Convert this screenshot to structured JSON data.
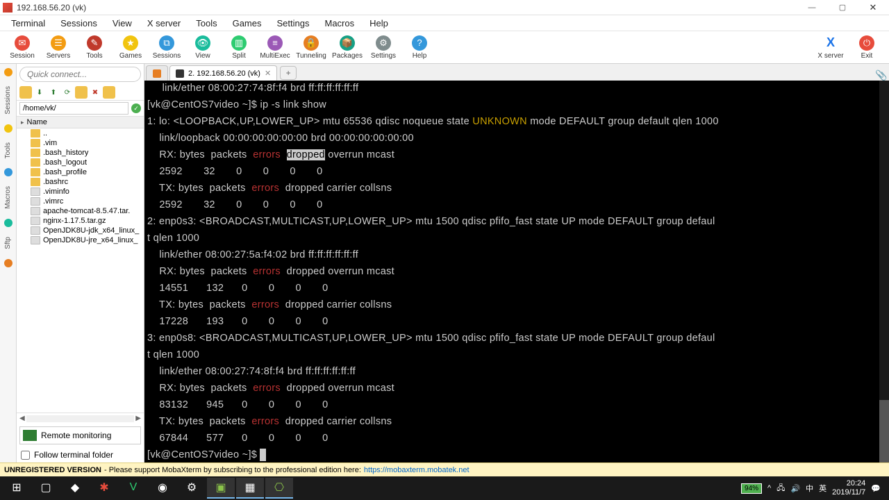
{
  "window": {
    "title": "192.168.56.20 (vk)"
  },
  "menu": [
    "Terminal",
    "Sessions",
    "View",
    "X server",
    "Tools",
    "Games",
    "Settings",
    "Macros",
    "Help"
  ],
  "toolbar": [
    {
      "label": "Session",
      "color": "#e74c3c",
      "glyph": "✉"
    },
    {
      "label": "Servers",
      "color": "#f39c12",
      "glyph": "☰"
    },
    {
      "label": "Tools",
      "color": "#c0392b",
      "glyph": "✎"
    },
    {
      "label": "Games",
      "color": "#f1c40f",
      "glyph": "★"
    },
    {
      "label": "Sessions",
      "color": "#3498db",
      "glyph": "⧉"
    },
    {
      "label": "View",
      "color": "#1abc9c",
      "glyph": "👁"
    },
    {
      "label": "Split",
      "color": "#2ecc71",
      "glyph": "▥"
    },
    {
      "label": "MultiExec",
      "color": "#9b59b6",
      "glyph": "≡"
    },
    {
      "label": "Tunneling",
      "color": "#e67e22",
      "glyph": "🔒"
    },
    {
      "label": "Packages",
      "color": "#16a085",
      "glyph": "📦"
    },
    {
      "label": "Settings",
      "color": "#7f8c8d",
      "glyph": "⚙"
    },
    {
      "label": "Help",
      "color": "#3498db",
      "glyph": "?"
    }
  ],
  "toolbar_right": [
    {
      "label": "X server",
      "glyph": "X"
    },
    {
      "label": "Exit",
      "glyph": "⏻"
    }
  ],
  "quick_placeholder": "Quick connect...",
  "leftstrip": [
    "Sessions",
    "Tools",
    "Macros",
    "Sftp"
  ],
  "path": "/home/vk/",
  "filehead": "Name",
  "files": [
    {
      "name": "..",
      "dir": true
    },
    {
      "name": ".vim",
      "dir": true
    },
    {
      "name": ".bash_history",
      "dir": true
    },
    {
      "name": ".bash_logout",
      "dir": true
    },
    {
      "name": ".bash_profile",
      "dir": true
    },
    {
      "name": ".bashrc",
      "dir": true
    },
    {
      "name": ".viminfo",
      "dir": false
    },
    {
      "name": ".vimrc",
      "dir": false
    },
    {
      "name": "apache-tomcat-8.5.47.tar.",
      "dir": false
    },
    {
      "name": "nginx-1.17.5.tar.gz",
      "dir": false
    },
    {
      "name": "OpenJDK8U-jdk_x64_linux_",
      "dir": false
    },
    {
      "name": "OpenJDK8U-jre_x64_linux_",
      "dir": false
    }
  ],
  "remote_mon": "Remote monitoring",
  "follow": "Follow terminal folder",
  "tabs": {
    "active_label": "2. 192.168.56.20 (vk)"
  },
  "term": {
    "l0": "     link/ether 08:00:27:74:8f:f4 brd ff:ff:ff:ff:ff:ff",
    "prompt1": "[vk@CentOS7video ~]$ ",
    "cmd": "ip -s link show",
    "i1a": "1: lo: <LOOPBACK,UP,LOWER_UP> mtu 65536 qdisc noqueue state ",
    "unk": "UNKNOWN",
    "i1b": " mode DEFAULT group default qlen 1000",
    "i1link": "    link/loopback 00:00:00:00:00:00 brd 00:00:00:00:00:00",
    "rxh_a": "    RX: bytes  packets  ",
    "err": "errors",
    "rxh_b": "  ",
    "dropped": "dropped",
    "rxh_c": " overrun mcast",
    "i1rx": "    2592       32       0       0       0       0",
    "txh_a": "    TX: bytes  packets  ",
    "txh_b": "  dropped carrier collsns",
    "i1tx": "    2592       32       0       0       0       0",
    "i2": "2: enp0s3: <BROADCAST,MULTICAST,UP,LOWER_UP> mtu 1500 qdisc pfifo_fast state UP mode DEFAULT group defaul",
    "i2b": "t qlen 1000",
    "i2link": "    link/ether 08:00:27:5a:f4:02 brd ff:ff:ff:ff:ff:ff",
    "rxh2_b": "  dropped overrun mcast",
    "i2rx": "    14551      132      0       0       0       0",
    "i2tx": "    17228      193      0       0       0       0",
    "i3": "3: enp0s8: <BROADCAST,MULTICAST,UP,LOWER_UP> mtu 1500 qdisc pfifo_fast state UP mode DEFAULT group defaul",
    "i3b": "t qlen 1000",
    "i3link": "    link/ether 08:00:27:74:8f:f4 brd ff:ff:ff:ff:ff:ff",
    "i3rx": "    83132      945      0       0       0       0",
    "i3tx": "    67844      577      0       0       0       0",
    "prompt2": "[vk@CentOS7video ~]$ "
  },
  "status": {
    "unreg": "UNREGISTERED VERSION",
    "msg": " - Please support MobaXterm by subscribing to the professional edition here: ",
    "url": "https://mobaxterm.mobatek.net"
  },
  "tray": {
    "battery": "94%",
    "ime1": "中",
    "ime2": "英",
    "time": "20:24",
    "date": "2019/11/7"
  }
}
